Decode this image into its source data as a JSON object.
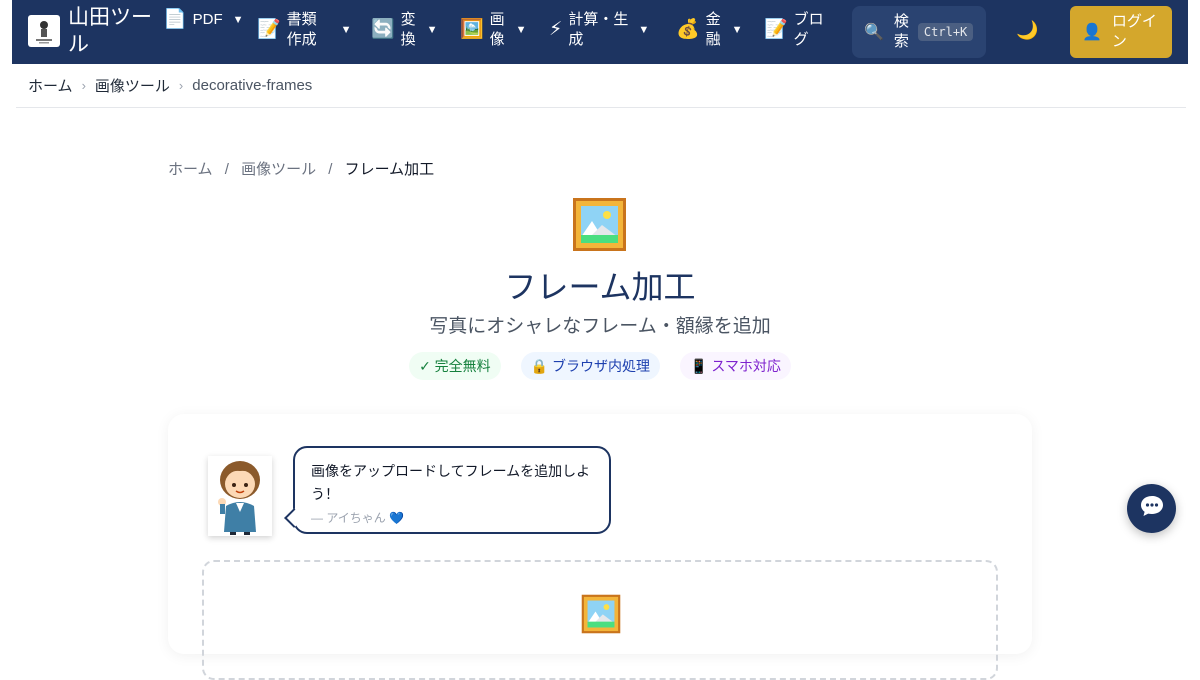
{
  "header": {
    "brand_name": "山田ツール",
    "nav": [
      {
        "icon": "📄",
        "label": "PDF"
      },
      {
        "icon": "📝",
        "label": "書類作成"
      },
      {
        "icon": "🔄",
        "label": "変換"
      },
      {
        "icon": "🖼️",
        "label": "画像"
      },
      {
        "icon": "⚡",
        "label": "計算・生成"
      },
      {
        "icon": "💰",
        "label": "金融"
      },
      {
        "icon": "📝",
        "label": "ブログ"
      }
    ],
    "caret": "▼",
    "search": {
      "icon": "🔍",
      "label": "検索",
      "shortcut": "Ctrl+K"
    },
    "theme_icon": "🌙",
    "login": {
      "icon": "👤",
      "label": "ログイン"
    }
  },
  "top_breadcrumb": {
    "items": [
      "ホーム",
      "画像ツール",
      "decorative-frames"
    ],
    "separator": "›"
  },
  "page": {
    "breadcrumb": {
      "items": [
        "ホーム",
        "画像ツール",
        "フレーム加工"
      ],
      "separator": "/"
    },
    "title": "フレーム加工",
    "subtitle": "写真にオシャレなフレーム・額縁を追加",
    "badges": [
      {
        "text": "✓ 完全無料",
        "color": "#15803d"
      },
      {
        "text": "🔒 ブラウザ内処理",
        "color": "#1e40af"
      },
      {
        "text": "📱 スマホ対応",
        "color": "#7e22ce"
      }
    ],
    "assistant": {
      "message": "画像をアップロードしてフレームを追加しよう！",
      "signature": "— アイちゃん 💙"
    }
  },
  "colors": {
    "navbar": "#1d3461",
    "accent_gold": "#d4a72c",
    "title": "#1d3461"
  }
}
